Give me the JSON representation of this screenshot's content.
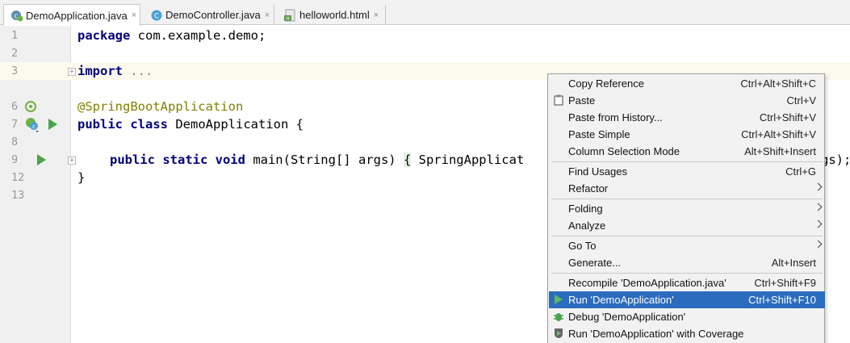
{
  "tabs": [
    {
      "label": "DemoApplication.java",
      "icon": "spring-boot-class-icon",
      "active": true
    },
    {
      "label": "DemoController.java",
      "icon": "java-class-icon",
      "active": false
    },
    {
      "label": "helloworld.html",
      "icon": "html-file-icon",
      "active": false
    }
  ],
  "tab_close_glyph": "×",
  "line_numbers": [
    "1",
    "2",
    "3",
    "6",
    "7",
    "8",
    "9",
    "12",
    "13"
  ],
  "code": {
    "l1_kw": "package",
    "l1_rest": " com.example.demo;",
    "l3_kw": "import",
    "l3_fold": " ...",
    "l6_ann": "@SpringBootApplication",
    "l7_kw1": "public",
    "l7_kw2": "class",
    "l7_rest": " DemoApplication {",
    "l9_kw": "public static void",
    "l9_mid": " main(String[] args) ",
    "l9_brace": "{",
    "l9_tail": " SpringApplicat",
    "l9_end": "gs);",
    "l12": "}"
  },
  "context_menu": {
    "items": [
      {
        "label": "Copy Reference",
        "shortcut": "Ctrl+Alt+Shift+C"
      },
      {
        "label": "Paste",
        "shortcut": "Ctrl+V",
        "icon": "clipboard-icon"
      },
      {
        "label": "Paste from History...",
        "shortcut": "Ctrl+Shift+V"
      },
      {
        "label": "Paste Simple",
        "shortcut": "Ctrl+Alt+Shift+V"
      },
      {
        "label": "Column Selection Mode",
        "shortcut": "Alt+Shift+Insert"
      },
      {
        "label": "Find Usages",
        "shortcut": "Ctrl+G"
      },
      {
        "label": "Refactor",
        "submenu": true
      },
      {
        "label": "Folding",
        "submenu": true
      },
      {
        "label": "Analyze",
        "submenu": true
      },
      {
        "label": "Go To",
        "submenu": true
      },
      {
        "label": "Generate...",
        "shortcut": "Alt+Insert"
      },
      {
        "label": "Recompile 'DemoApplication.java'",
        "shortcut": "Ctrl+Shift+F9"
      },
      {
        "label": "Run 'DemoApplication'",
        "shortcut": "Ctrl+Shift+F10",
        "selected": true,
        "icon": "run-icon"
      },
      {
        "label": "Debug 'DemoApplication'",
        "icon": "debug-icon"
      },
      {
        "label": "Run 'DemoApplication' with Coverage",
        "icon": "coverage-icon"
      }
    ]
  },
  "colors": {
    "keyword": "#000080",
    "annotation": "#808000",
    "menu_selection": "#2b6cbf",
    "run_green": "#4aa44a"
  }
}
